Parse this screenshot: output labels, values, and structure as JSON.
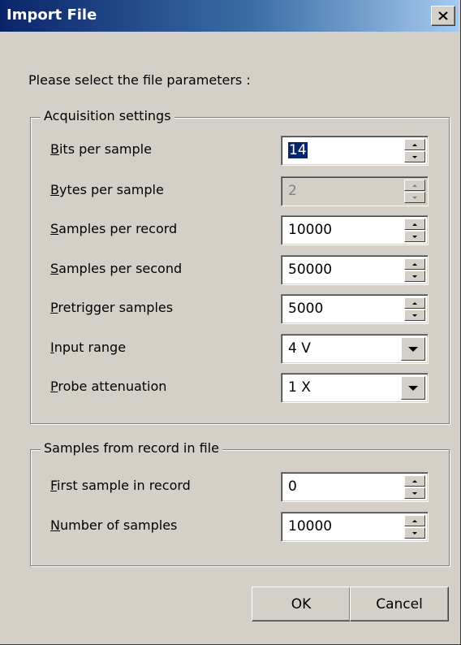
{
  "window": {
    "title": "Import File",
    "close_symbol": "×"
  },
  "intro": "Please select the file parameters :",
  "acquisition": {
    "legend": "Acquisition settings",
    "rows": [
      {
        "label_acc": "B",
        "label_rest": "its per sample",
        "value": "14",
        "kind": "spin",
        "selected": true,
        "disabled": false
      },
      {
        "label_acc": "B",
        "label_rest": "ytes per sample",
        "value": "2",
        "kind": "spin",
        "selected": false,
        "disabled": true
      },
      {
        "label_acc": "S",
        "label_rest": "amples per record",
        "value": "10000",
        "kind": "spin",
        "selected": false,
        "disabled": false
      },
      {
        "label_acc": "S",
        "label_rest": "amples per second",
        "value": "50000",
        "kind": "spin",
        "selected": false,
        "disabled": false
      },
      {
        "label_acc": "P",
        "label_rest": "retrigger samples",
        "value": "5000",
        "kind": "spin",
        "selected": false,
        "disabled": false
      },
      {
        "label_acc": "I",
        "label_rest": "nput range",
        "value": "4 V",
        "kind": "dropdown",
        "selected": false,
        "disabled": false
      },
      {
        "label_acc": "P",
        "label_rest": "robe attenuation",
        "value": "1 X",
        "kind": "dropdown",
        "selected": false,
        "disabled": false
      }
    ]
  },
  "samples": {
    "legend": "Samples from record in file",
    "rows": [
      {
        "label_acc": "F",
        "label_rest": "irst sample in record",
        "value": "0",
        "kind": "spin",
        "selected": false,
        "disabled": false
      },
      {
        "label_acc": "N",
        "label_rest": "umber of samples",
        "value": "10000",
        "kind": "spin",
        "selected": false,
        "disabled": false
      }
    ]
  },
  "buttons": {
    "ok": "OK",
    "cancel": "Cancel"
  },
  "icons": {
    "close": "close-icon",
    "spin_up": "spin-up-arrow-icon",
    "spin_down": "spin-down-arrow-icon",
    "dropdown": "dropdown-arrow-icon"
  }
}
